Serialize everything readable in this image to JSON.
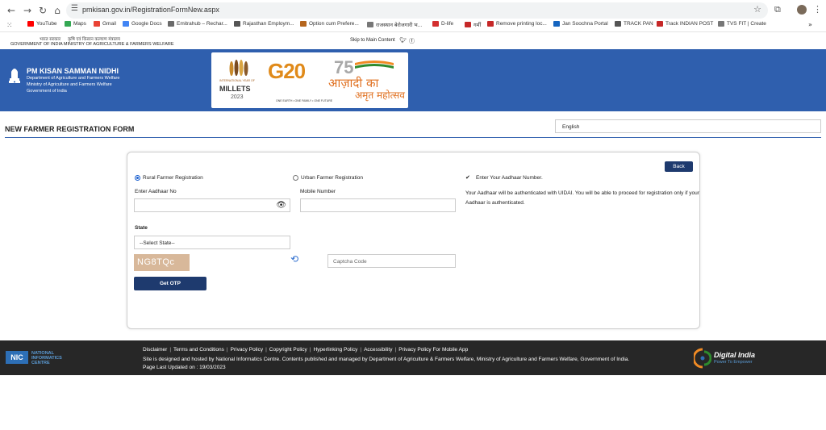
{
  "browser": {
    "url": "pmkisan.gov.in/RegistrationFormNew.aspx",
    "bookmarks": [
      {
        "label": "YouTube",
        "color": "#ff0000"
      },
      {
        "label": "Maps",
        "color": "#34a853"
      },
      {
        "label": "Gmail",
        "color": "#ea4335"
      },
      {
        "label": "Google Docs",
        "color": "#4285f4"
      },
      {
        "label": "Emitrahub – Rechar...",
        "color": "#6a6a6a"
      },
      {
        "label": "Rajasthan Employm...",
        "color": "#555555"
      },
      {
        "label": "Option cum Prefere...",
        "color": "#b5651d"
      },
      {
        "label": "राजस्थान बेरोजगारी भ...",
        "color": "#777777"
      },
      {
        "label": "D-life",
        "color": "#d32f2f"
      },
      {
        "label": "गर्मी",
        "color": "#c62828"
      },
      {
        "label": "Remove printing loc...",
        "color": "#c62828"
      },
      {
        "label": "Jan Soochna Portal",
        "color": "#1565c0"
      },
      {
        "label": "TRACK PAN",
        "color": "#555555"
      },
      {
        "label": "Track INDIAN POST",
        "color": "#c62828"
      },
      {
        "label": "TVS FIT | Create",
        "color": "#777777"
      }
    ]
  },
  "gov_strip": {
    "hindi_gov": "भारत सरकार",
    "hindi_ministry": "कृषि एवं किसान कल्याण मंत्रालय",
    "english": "GOVERNMENT OF INDIA   MINISTRY OF AGRICULTURE & FARMERS WELFARE",
    "skip": "Skip to Main Content"
  },
  "header": {
    "title": "PM KISAN SAMMAN NIDHI",
    "lines": [
      "Department of Agriculture and Farmers Welfare",
      "Ministry of Agriculture and Farmers Welfare",
      "Government of India"
    ],
    "banner": {
      "intl": "INTERNATIONAL YEAR OF",
      "millets": "MILLETS",
      "year": "2023",
      "g20": "G20",
      "g20_tag": "ONE EARTH • ONE FAMILY • ONE FUTURE",
      "s75": "75",
      "azadi": "आज़ादी का",
      "amrit": "अमृत महोत्सव"
    }
  },
  "form": {
    "title": "NEW FARMER REGISTRATION FORM",
    "language": "English",
    "rural_label": "Rural Farmer Registration",
    "urban_label": "Urban Farmer Registration",
    "aadhaar_label": "Enter Aadhaar No",
    "aadhaar_value": "",
    "mobile_label": "Mobile Number",
    "mobile_value": "",
    "state_label": "State",
    "state_selected": "--Select State--",
    "captcha_text": "NG8TQc",
    "captcha_placeholder": "Captcha Code",
    "get_otp": "Get OTP",
    "back": "Back",
    "aadhaar_heading": "Enter Your Aadhaar Number.",
    "note": "Your Aadhaar will be authenticated with UIDAI. You will be able to proceed for registration only if your Aadhaar is authenticated."
  },
  "footer": {
    "nic": "NIC",
    "nic_text_1": "NATIONAL",
    "nic_text_2": "INFORMATICS",
    "nic_text_3": "CENTRE",
    "links": [
      "Disclaimer",
      "Terms and Conditions",
      "Privacy Policy",
      "Copyright Policy",
      "Hyperlinking Policy",
      "Accessibility",
      "Privacy Policy For Mobile App"
    ],
    "hosted": "Site is designed and hosted by National Informatics Centre. Contents published and managed by Department of Agriculture & Farmers Welfare, Ministry of Agriculture and Farmers Welfare, Government of India.",
    "updated": "Page Last Updated on : 19/03/2023",
    "digital_india": "Digital India",
    "di_tag": "Power To Empower"
  }
}
